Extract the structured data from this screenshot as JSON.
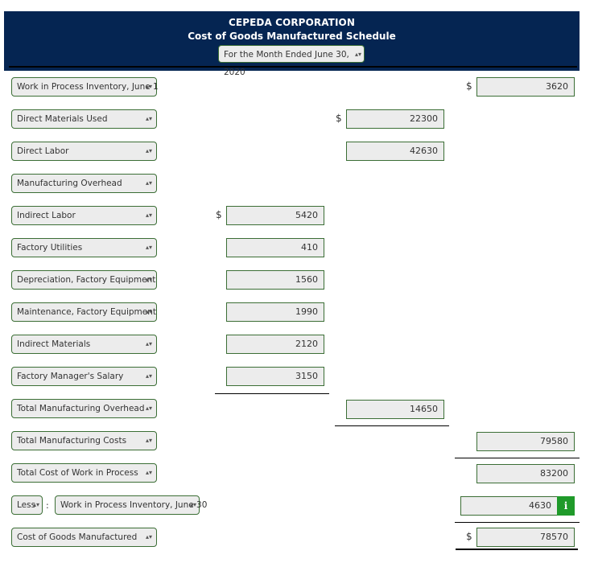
{
  "header": {
    "company": "CEPEDA CORPORATION",
    "title": "Cost of Goods Manufactured Schedule",
    "period": "For the Month Ended June 30, 2020"
  },
  "currency_symbol": "$",
  "arrows_glyph": "▴▾",
  "colon": ":",
  "rows": {
    "wip_begin": {
      "label": "Work in Process Inventory, June 1",
      "value": "3620"
    },
    "dm_used": {
      "label": "Direct Materials Used",
      "value": "22300"
    },
    "direct_labor": {
      "label": "Direct Labor",
      "value": "42630"
    },
    "mfg_overhead": {
      "label": "Manufacturing Overhead"
    },
    "indirect_labor": {
      "label": "Indirect Labor",
      "value": "5420"
    },
    "utilities": {
      "label": "Factory Utilities",
      "value": "410"
    },
    "depreciation": {
      "label": "Depreciation, Factory Equipment",
      "value": "1560"
    },
    "maintenance": {
      "label": "Maintenance, Factory Equipment",
      "value": "1990"
    },
    "indirect_mat": {
      "label": "Indirect Materials",
      "value": "2120"
    },
    "mgr_salary": {
      "label": "Factory Manager's Salary",
      "value": "3150"
    },
    "total_overhead": {
      "label": "Total Manufacturing Overhead",
      "value": "14650"
    },
    "total_mfg": {
      "label": "Total Manufacturing Costs",
      "value": "79580"
    },
    "total_wip": {
      "label": "Total Cost of Work in Process",
      "value": "83200"
    },
    "less": {
      "prefix": "Less",
      "label": "Work in Process Inventory, June 30",
      "value": "4630"
    },
    "cogm": {
      "label": "Cost of Goods Manufactured",
      "value": "78570"
    }
  },
  "info_button": {
    "glyph": "i",
    "color": "#1f9a2a"
  }
}
